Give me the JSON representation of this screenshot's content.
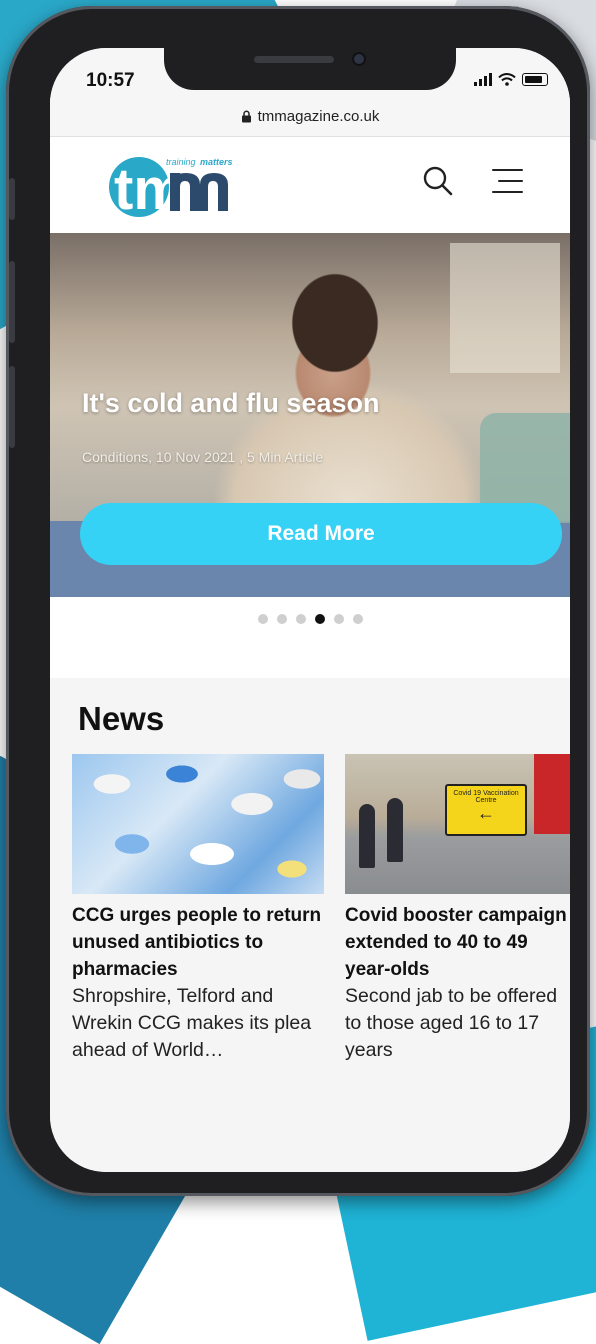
{
  "status_bar": {
    "time": "10:57"
  },
  "browser": {
    "url": "tmmagazine.co.uk"
  },
  "header": {
    "logo_text": "tm",
    "logo_tagline_1": "training",
    "logo_tagline_2": "matters"
  },
  "hero": {
    "title": "It's cold and flu season",
    "meta": "Conditions, 10 Nov 2021 , 5 Min Article",
    "button_label": "Read More",
    "carousel": {
      "count": 6,
      "active_index": 3
    }
  },
  "news": {
    "heading": "News",
    "articles": [
      {
        "title": "CCG urges people to return unused antibiotics to pharmacies",
        "description": "Shropshire, Telford and Wrekin CCG makes its plea ahead of World…"
      },
      {
        "title": "Covid booster campaign extended to 40 to 49 year-olds",
        "description": "Second jab to be offered to those aged 16 to 17 years",
        "sign_text": "Covid 19 Vaccination Centre"
      }
    ]
  },
  "colors": {
    "accent": "#35d2f5",
    "hero_band": "#6a86ad",
    "logo_cyan": "#2aa8c8",
    "logo_navy": "#2c4a6b"
  }
}
